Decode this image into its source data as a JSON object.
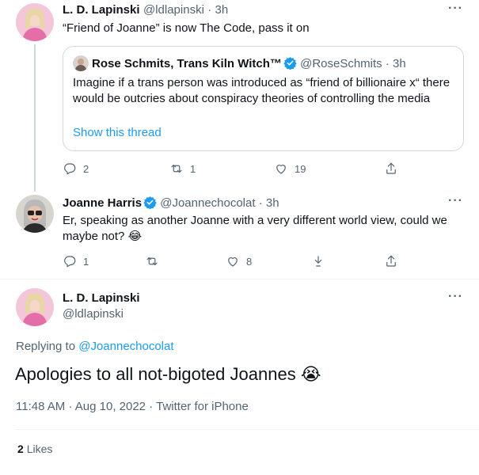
{
  "tweet1": {
    "name": "L. D. Lapinski",
    "handle": "@ldlapinski",
    "time": "· 3h",
    "text": "“Friend of Joanne” is now The Code, pass it on",
    "more": "···",
    "quote": {
      "name": "Rose Schmits, Trans Kiln Witch™",
      "handle": "@RoseSchmits",
      "time": "· 3h",
      "text": "Imagine if a trans person was introduced as “friend of billionaire x“ there would be outcries about conspiracy theories of controlling the media",
      "show_thread": "Show this thread"
    },
    "replies": "2",
    "retweets": "1",
    "likes": "19"
  },
  "tweet2": {
    "name": "Joanne Harris",
    "handle": "@Joannechocolat",
    "time": "· 3h",
    "text": "Er, speaking as another Joanne with a very different world view, could we maybe not?",
    "emoji": "😂",
    "more": "···",
    "replies": "1",
    "likes": "8"
  },
  "main": {
    "name": "L. D. Lapinski",
    "handle": "@ldlapinski",
    "more": "···",
    "replying_prefix": "Replying to",
    "replying_to": "@Joannechocolat",
    "text": "Apologies to all not-bigoted Joannes",
    "emoji": "😭",
    "time": "11:48 AM",
    "date": "Aug 10, 2022",
    "source": "Twitter for iPhone",
    "likes_count": "2",
    "likes_label": "Likes"
  },
  "colors": {
    "link": "#1d9bf0",
    "muted": "#536471",
    "border": "#cfd9de"
  },
  "icons": [
    "reply-icon",
    "retweet-icon",
    "like-icon",
    "share-icon",
    "download-icon",
    "verified-badge-icon",
    "more-icon"
  ]
}
